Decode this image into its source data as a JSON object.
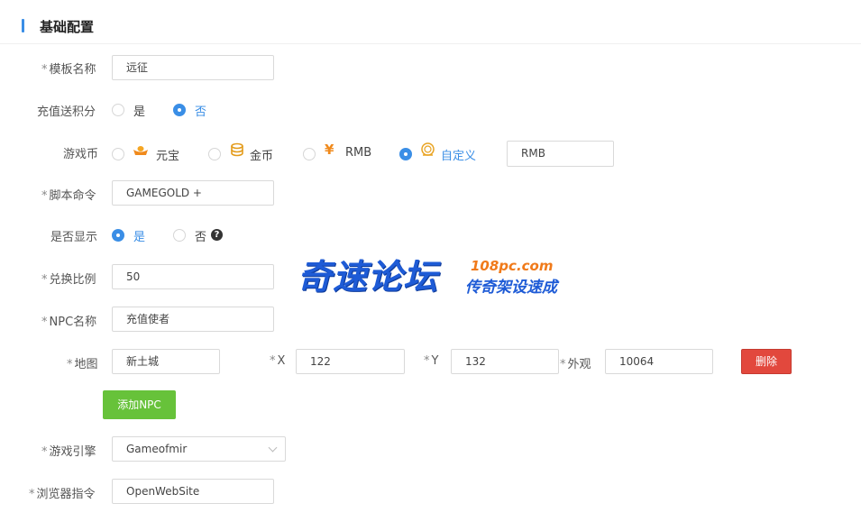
{
  "section": {
    "title": "基础配置"
  },
  "form": {
    "template_name": {
      "label": "模板名称",
      "value": "远征"
    },
    "recharge_points": {
      "label": "充值送积分",
      "options": [
        "是",
        "否"
      ],
      "selected": "否"
    },
    "game_currency": {
      "label": "游戏币",
      "options": [
        {
          "label": "元宝",
          "icon": "ingot-icon"
        },
        {
          "label": "金币",
          "icon": "gold-coins-icon"
        },
        {
          "label": "RMB",
          "icon": "yen-icon"
        },
        {
          "label": "自定义",
          "icon": "custom-coin-icon"
        }
      ],
      "selected": "自定义",
      "custom_value": "RMB"
    },
    "script_command": {
      "label": "脚本命令",
      "value": "GAMEGOLD +"
    },
    "show": {
      "label": "是否显示",
      "options": [
        "是",
        "否"
      ],
      "selected": "是"
    },
    "exchange_ratio": {
      "label": "兑换比例",
      "value": "50"
    },
    "npc_name": {
      "label": "NPC名称",
      "value": "充值使者"
    },
    "npc": {
      "map_label": "地图",
      "map_value": "新土城",
      "x_label": "X",
      "x_value": "122",
      "y_label": "Y",
      "y_value": "132",
      "look_label": "外观",
      "look_value": "10064",
      "delete_label": "删除"
    },
    "add_npc_label": "添加NPC",
    "game_engine": {
      "label": "游戏引擎",
      "value": "Gameofmir"
    },
    "browser_command": {
      "label": "浏览器指令",
      "value": "OpenWebSite"
    }
  },
  "watermark": {
    "main": "奇速论坛",
    "url": "108pc.com",
    "sub": "传奇架设速成"
  },
  "colors": {
    "accent": "#3a8ee6",
    "add_button": "#67c23a",
    "delete_button": "#e2483d"
  }
}
